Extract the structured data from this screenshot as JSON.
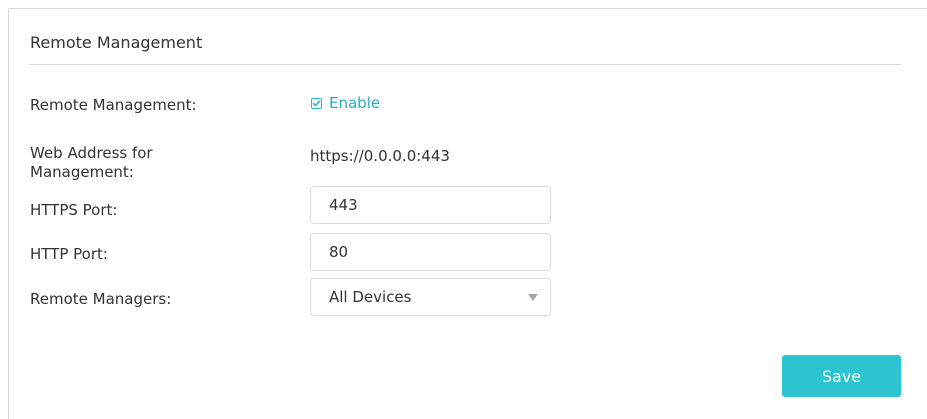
{
  "section": {
    "title": "Remote Management"
  },
  "remote_management": {
    "label": "Remote Management:",
    "checkbox_label": "Enable",
    "checked": true
  },
  "web_address": {
    "label": "Web Address for Management:",
    "value": "https://0.0.0.0:443"
  },
  "https_port": {
    "label": "HTTPS Port:",
    "value": "443"
  },
  "http_port": {
    "label": "HTTP Port:",
    "value": "80"
  },
  "remote_managers": {
    "label": "Remote Managers:",
    "selected": "All Devices"
  },
  "actions": {
    "save_label": "Save"
  },
  "colors": {
    "accent": "#2bc4d0",
    "link_text": "#21b0c4",
    "border": "#d9d9d9"
  }
}
